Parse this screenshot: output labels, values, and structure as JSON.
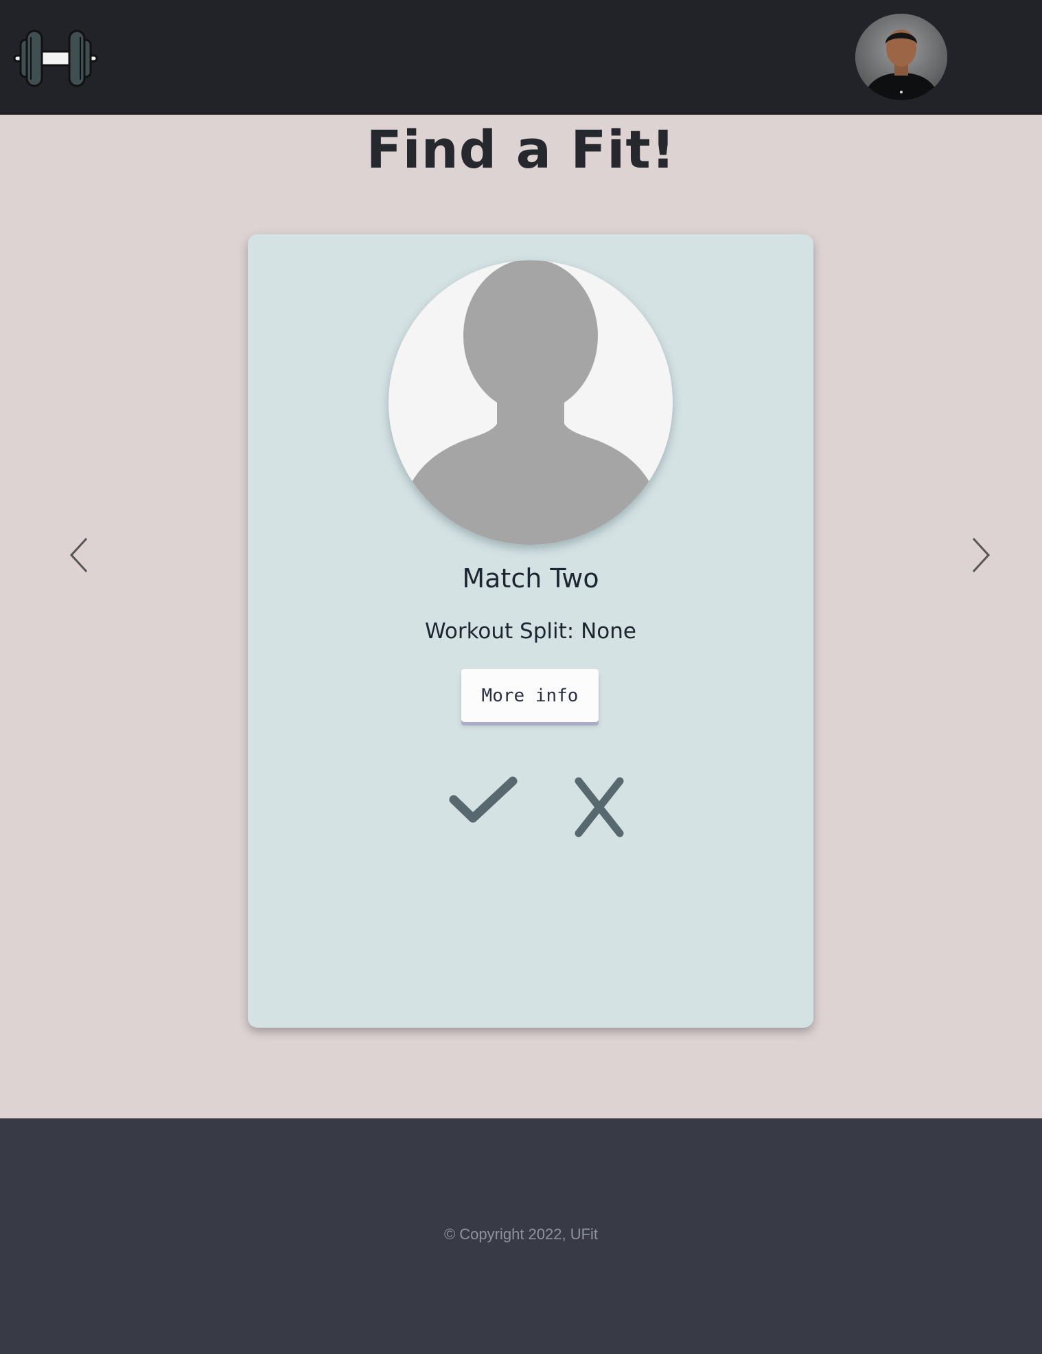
{
  "header": {
    "logo_icon": "dumbbell-icon",
    "avatar_icon": "user-avatar-photo"
  },
  "page": {
    "title": "Find a Fit!"
  },
  "carousel": {
    "prev_icon": "chevron-left-icon",
    "next_icon": "chevron-right-icon"
  },
  "match_card": {
    "photo_icon": "default-profile-silhouette",
    "name": "Match Two",
    "workout_split": "Workout Split: None",
    "more_info_label": "More info",
    "accept_icon": "checkmark-icon",
    "reject_icon": "x-icon"
  },
  "footer": {
    "copyright": "© Copyright 2022, UFit"
  },
  "colors": {
    "topbar": "#212329",
    "background": "#ddd3d3",
    "card": "#d5e2e4",
    "footer": "#383b45",
    "action_icon": "#58686f"
  }
}
